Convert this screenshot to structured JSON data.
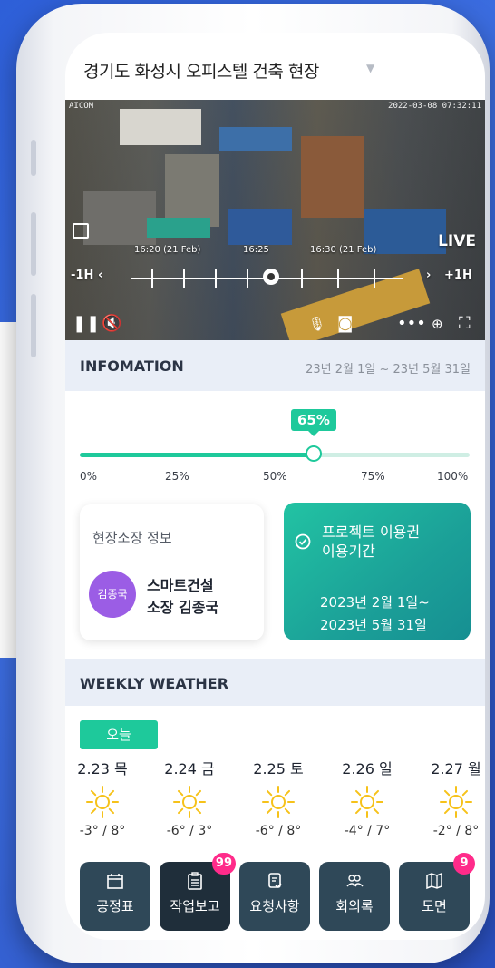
{
  "site": {
    "title": "경기도 화성시 오피스텔 건축 현장",
    "dropdown_icon": "chevron-down-icon"
  },
  "video": {
    "camera_label": "AICOM",
    "timestamp": "2022-03-08 07:32:11",
    "live_label": "LIVE",
    "timeline": {
      "labels": [
        "16:20 (21 Feb)",
        "16:25",
        "16:30 (21 Feb)"
      ],
      "prev_label": "-1H",
      "next_label": "+1H"
    }
  },
  "information": {
    "title": "INFOMATION",
    "date_range": "23년 2월 1일 ~ 23년 5월 31일",
    "progress": {
      "value_label": "65%",
      "fraction": 0.6
    },
    "ticks": [
      "0%",
      "25%",
      "50%",
      "75%",
      "100%"
    ],
    "manager_card": {
      "title": "현장소장 정보",
      "avatar_text": "김종국",
      "company": "스마트건설",
      "name": "소장 김종국"
    },
    "pass_card": {
      "title_line1": "프로젝트 이용권",
      "title_line2": "이용기간",
      "start": "2023년 2월 1일~",
      "end": "2023년 5월 31일"
    }
  },
  "weather": {
    "title": "WEEKLY WEATHER",
    "today_label": "오늘",
    "days": [
      {
        "date": "2.23 목",
        "temp": "-3° / 8°",
        "icon": "sun-icon"
      },
      {
        "date": "2.24 금",
        "temp": "-6° / 3°",
        "icon": "sun-icon"
      },
      {
        "date": "2.25 토",
        "temp": "-6° / 8°",
        "icon": "sun-icon"
      },
      {
        "date": "2.26 일",
        "temp": "-4° / 7°",
        "icon": "sun-icon"
      },
      {
        "date": "2.27 월",
        "temp": "-2° / 8°",
        "icon": "sun-icon"
      }
    ]
  },
  "bottom_nav": [
    {
      "label": "공정표",
      "icon": "calendar-icon",
      "badge": ""
    },
    {
      "label": "작업보고",
      "icon": "clipboard-icon",
      "badge": "99"
    },
    {
      "label": "요청사항",
      "icon": "request-icon",
      "badge": ""
    },
    {
      "label": "회의록",
      "icon": "people-icon",
      "badge": ""
    },
    {
      "label": "도면",
      "icon": "map-icon",
      "badge": "9"
    }
  ],
  "colors": {
    "accent": "#1ec99b",
    "nav_bg": "#2f4858",
    "badge": "#ff2b8a",
    "avatar": "#9b5de5"
  }
}
